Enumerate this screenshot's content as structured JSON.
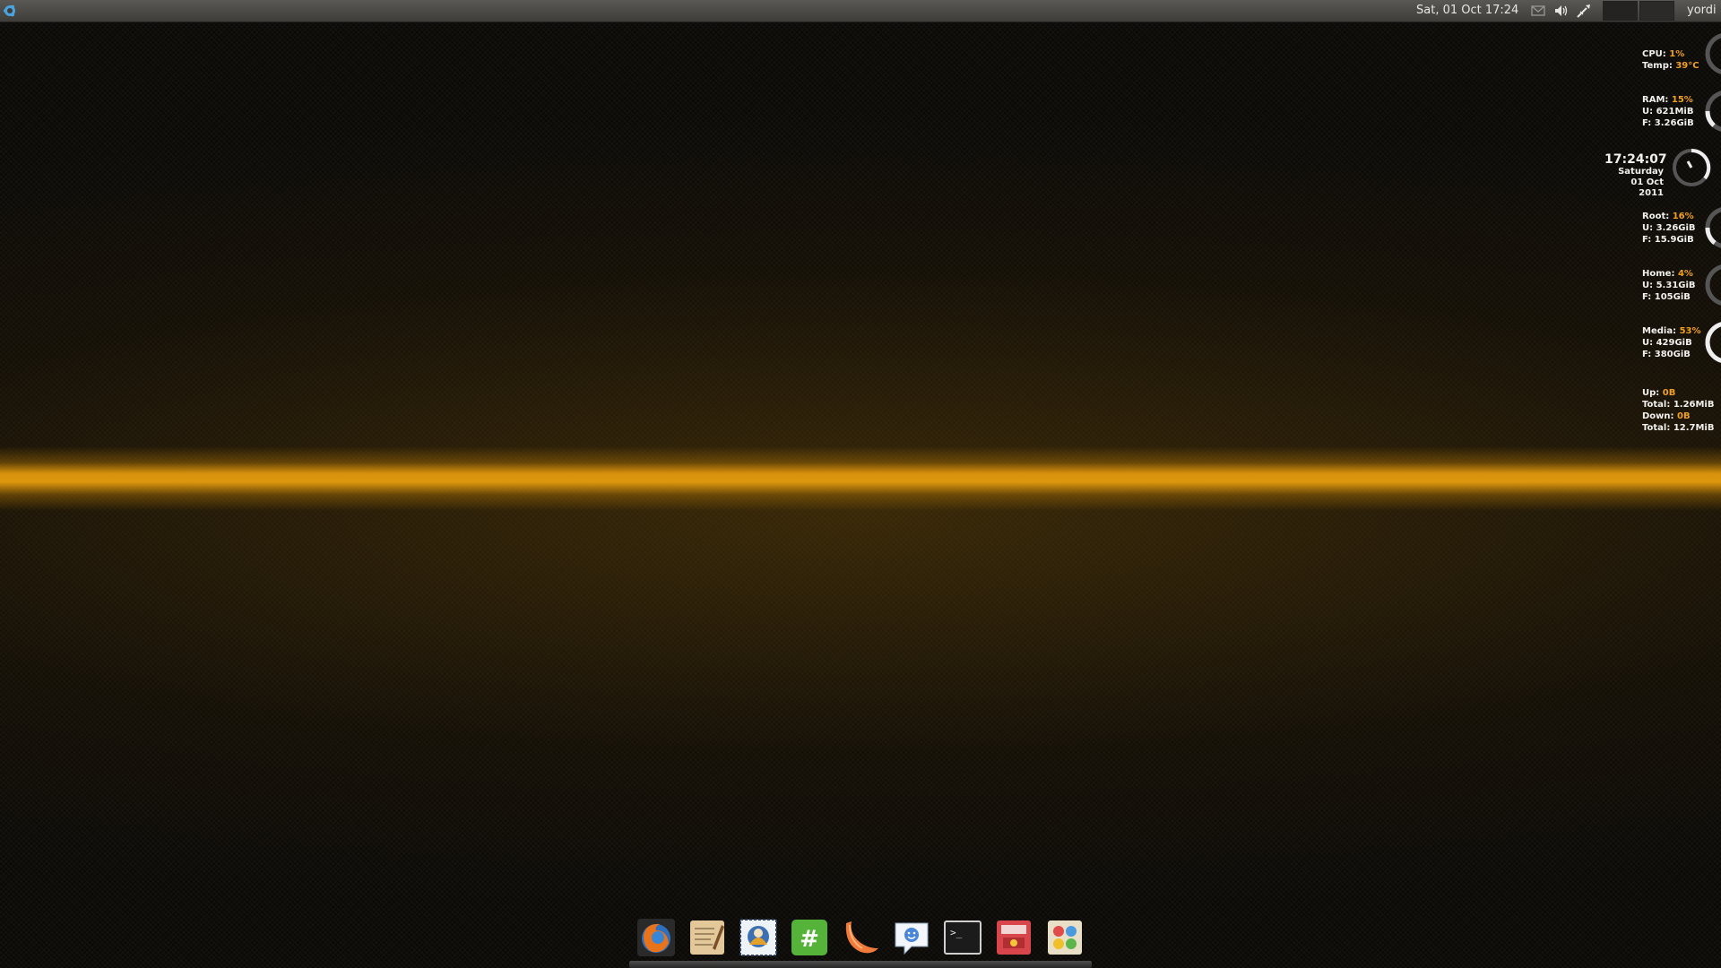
{
  "topbar": {
    "datetime": "Sat, 01 Oct  17:24",
    "user": "yordi"
  },
  "colors": {
    "accent": "#f0a020",
    "panel": "#4a4845",
    "glow": "#d8940c"
  },
  "icons": [
    "ubuntu-logo-icon",
    "mail-icon",
    "volume-icon",
    "network-tool-icon"
  ],
  "conky": {
    "cpu": {
      "label": "CPU:",
      "value": "1%",
      "temp_label": "Temp:",
      "temp": "39°C",
      "usage": 0.01
    },
    "ram": {
      "label": "RAM:",
      "value": "15%",
      "used": "U: 621MiB",
      "free": "F: 3.26GiB",
      "usage": 0.15
    },
    "clock": {
      "time": "17:24:07",
      "day": "Saturday",
      "date": "01 Oct 2011"
    },
    "root": {
      "label": "Root:",
      "value": "16%",
      "used": "U: 3.26GiB",
      "free": "F: 15.9GiB",
      "usage": 0.16
    },
    "home": {
      "label": "Home:",
      "value": "4%",
      "used": "U: 5.31GiB",
      "free": "F: 105GiB",
      "usage": 0.04
    },
    "media": {
      "label": "Media:",
      "value": "53%",
      "used": "U: 429GiB",
      "free": "F: 380GiB",
      "usage": 0.53
    },
    "net": {
      "up_label": "Up:",
      "up": "0B",
      "up_total_label": "Total:",
      "up_total": "1.26MiB",
      "down_label": "Down:",
      "down": "0B",
      "down_total_label": "Total:",
      "down_total": "12.7MiB"
    }
  },
  "dock": {
    "items": [
      "firefox-icon",
      "text-editor-icon",
      "mail-client-icon",
      "identica-icon",
      "clementine-icon",
      "chat-icon",
      "terminal-icon",
      "software-center-icon",
      "appearance-icon"
    ]
  }
}
